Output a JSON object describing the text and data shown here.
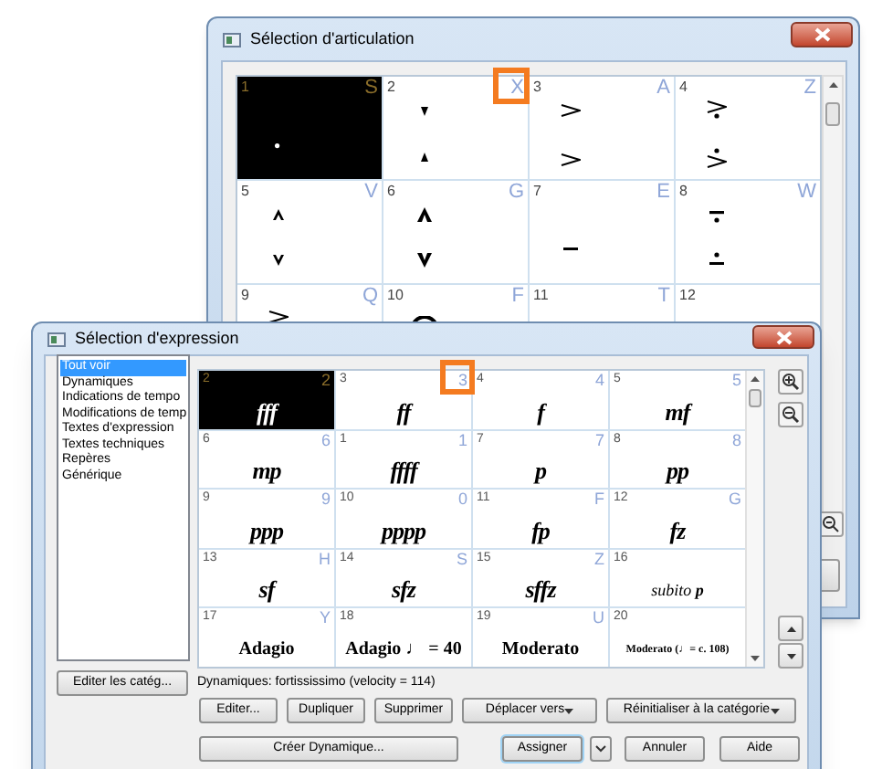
{
  "articulation_window": {
    "title": "Sélection d'articulation",
    "cells": [
      {
        "number": "1",
        "key": "S",
        "kind": "staccato",
        "selected": true,
        "key_highlighted": false
      },
      {
        "number": "2",
        "key": "X",
        "kind": "staccatissimo",
        "selected": false,
        "key_highlighted": true
      },
      {
        "number": "3",
        "key": "A",
        "kind": "accent",
        "selected": false,
        "key_highlighted": false
      },
      {
        "number": "4",
        "key": "Z",
        "kind": "accent-staccato",
        "selected": false,
        "key_highlighted": false
      },
      {
        "number": "5",
        "key": "V",
        "kind": "marcato",
        "selected": false,
        "key_highlighted": false
      },
      {
        "number": "6",
        "key": "G",
        "kind": "marcato-heavy",
        "selected": false,
        "key_highlighted": false
      },
      {
        "number": "7",
        "key": "E",
        "kind": "tenuto",
        "selected": false,
        "key_highlighted": false
      },
      {
        "number": "8",
        "key": "W",
        "kind": "tenuto-staccato",
        "selected": false,
        "key_highlighted": false
      },
      {
        "number": "9",
        "key": "Q",
        "kind": "accent-tenuto",
        "selected": false,
        "key_highlighted": false
      },
      {
        "number": "10",
        "key": "F",
        "kind": "fermata",
        "selected": false,
        "key_highlighted": false
      },
      {
        "number": "11",
        "key": "T",
        "kind": "none",
        "selected": false,
        "key_highlighted": false
      },
      {
        "number": "12",
        "kind": "none",
        "selected": false,
        "key_highlighted": false
      }
    ]
  },
  "expression_window": {
    "title": "Sélection d'expression",
    "categories": [
      {
        "label": "Tout voir",
        "selected": true
      },
      {
        "label": "Dynamiques",
        "selected": false
      },
      {
        "label": "Indications de tempo",
        "selected": false
      },
      {
        "label": "Modifications de temp",
        "selected": false
      },
      {
        "label": "Textes d'expression",
        "selected": false
      },
      {
        "label": "Textes techniques",
        "selected": false
      },
      {
        "label": "Repères",
        "selected": false
      },
      {
        "label": "Générique",
        "selected": false
      }
    ],
    "cells": [
      {
        "number": "2",
        "key": "2",
        "text": "fff",
        "kind": "dynamic",
        "selected": true,
        "key_highlighted": false
      },
      {
        "number": "3",
        "key": "3",
        "text": "ff",
        "kind": "dynamic",
        "selected": false,
        "key_highlighted": true
      },
      {
        "number": "4",
        "key": "4",
        "text": "f",
        "kind": "dynamic",
        "selected": false,
        "key_highlighted": false
      },
      {
        "number": "5",
        "key": "5",
        "text": "mf",
        "kind": "dynamic",
        "selected": false,
        "key_highlighted": false
      },
      {
        "number": "6",
        "key": "6",
        "text": "mp",
        "kind": "dynamic",
        "selected": false,
        "key_highlighted": false
      },
      {
        "number": "1",
        "key": "1",
        "text": "ffff",
        "kind": "dynamic",
        "selected": false,
        "key_highlighted": false
      },
      {
        "number": "7",
        "key": "7",
        "text": "p",
        "kind": "dynamic",
        "selected": false,
        "key_highlighted": false
      },
      {
        "number": "8",
        "key": "8",
        "text": "pp",
        "kind": "dynamic",
        "selected": false,
        "key_highlighted": false
      },
      {
        "number": "9",
        "key": "9",
        "text": "ppp",
        "kind": "dynamic",
        "selected": false,
        "key_highlighted": false
      },
      {
        "number": "10",
        "key": "0",
        "text": "pppp",
        "kind": "dynamic",
        "selected": false,
        "key_highlighted": false
      },
      {
        "number": "11",
        "key": "F",
        "text": "fp",
        "kind": "dynamic",
        "selected": false,
        "key_highlighted": false
      },
      {
        "number": "12",
        "key": "G",
        "text": "fz",
        "kind": "dynamic",
        "selected": false,
        "key_highlighted": false
      },
      {
        "number": "13",
        "key": "H",
        "text": "sf",
        "kind": "dynamic",
        "selected": false,
        "key_highlighted": false
      },
      {
        "number": "14",
        "key": "S",
        "text": "sfz",
        "kind": "dynamic",
        "selected": false,
        "key_highlighted": false
      },
      {
        "number": "15",
        "key": "Z",
        "text": "sffz",
        "kind": "dynamic",
        "selected": false,
        "key_highlighted": false
      },
      {
        "number": "16",
        "text": "subito **p**",
        "kind": "phrase",
        "selected": false,
        "key_highlighted": false
      },
      {
        "number": "17",
        "key": "Y",
        "text": "Adagio",
        "kind": "tempo",
        "selected": false,
        "key_highlighted": false
      },
      {
        "number": "18",
        "text": "Adagio ♩ = 40",
        "kind": "tempo",
        "selected": false,
        "key_highlighted": false
      },
      {
        "number": "19",
        "key": "U",
        "text": "Moderato",
        "kind": "tempo",
        "selected": false,
        "key_highlighted": false
      },
      {
        "number": "20",
        "text": "Moderato (♩= c. 108)",
        "kind": "tempo-small",
        "selected": false,
        "key_highlighted": false
      }
    ],
    "edit_categories_button": "Editer les catég...",
    "status": "Dynamiques: fortississimo (velocity = 114)",
    "buttons": [
      "Editer...",
      "Dupliquer",
      "Supprimer"
    ],
    "dropdowns": [
      "Déplacer vers",
      "Réinitialiser à la catégorie"
    ],
    "create_button": "Créer Dynamique...",
    "assign_button": "Assigner",
    "cancel_button": "Annuler",
    "help_button": "Aide"
  }
}
